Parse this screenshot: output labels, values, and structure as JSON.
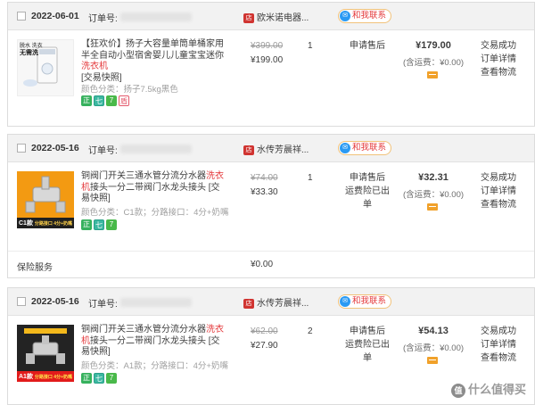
{
  "orders": [
    {
      "date": "2022-06-01",
      "order_label": "订单号:",
      "shop_name": "欧米诺电器...",
      "shop_icon": "店",
      "contact": "和我联系",
      "contact_icon": "✉",
      "title_pre": "【狂欢价】扬子大容量单筒单桶家用半全自动小型宿舍婴儿儿童宝宝迷你",
      "title_hl": "洗衣机",
      "title_post": "[交易快照]",
      "spec": "颜色分类：扬子7.5kg黑色",
      "thumb_text_1": "脱水 洗衣",
      "thumb_text_2": "无需洗",
      "orig_price": "¥399.00",
      "price": "¥199.00",
      "qty": "1",
      "after_sale": [
        "申请售后"
      ],
      "total": "¥179.00",
      "shipping": "(含运费：¥0.00)",
      "actions": [
        "交易成功",
        "订单详情",
        "查看物流"
      ],
      "badges": [
        "正",
        "七",
        "7",
        "盾"
      ]
    },
    {
      "date": "2022-05-16",
      "order_label": "订单号:",
      "shop_name": "水传芳晨祥...",
      "shop_icon": "店",
      "contact": "和我联系",
      "contact_icon": "✉",
      "title_pre": "铜阀门开关三通水管分流分水器",
      "title_hl": "洗衣机",
      "title_post": "接头一分二带阀门水龙头接头 [交易快照]",
      "spec": "颜色分类：C1款；分路接口：4分+奶嘴",
      "thumb_text_1": "C1款",
      "thumb_text_2": "分路接口 4分+奶嘴",
      "orig_price": "¥74.00",
      "price": "¥33.30",
      "qty": "1",
      "after_sale": [
        "申请售后",
        "运费险已出单"
      ],
      "total": "¥32.31",
      "shipping": "(含运费：¥0.00)",
      "actions": [
        "交易成功",
        "订单详情",
        "查看物流"
      ],
      "badges": [
        "正",
        "七",
        "7"
      ],
      "service_label": "保险服务",
      "service_price": "¥0.00"
    },
    {
      "date": "2022-05-16",
      "order_label": "订单号:",
      "shop_name": "水传芳晨祥...",
      "shop_icon": "店",
      "contact": "和我联系",
      "contact_icon": "✉",
      "title_pre": "铜阀门开关三通水管分流分水器",
      "title_hl": "洗衣机",
      "title_post": "接头一分二带阀门水龙头接头 [交易快照]",
      "spec": "颜色分类：A1款；分路接口：4分+奶嘴",
      "thumb_text_1": "A1款",
      "thumb_text_2": "分路接口 4分+奶嘴",
      "orig_price": "¥62.00",
      "price": "¥27.90",
      "qty": "2",
      "after_sale": [
        "申请售后",
        "运费险已出单"
      ],
      "total": "¥54.13",
      "shipping": "(含运费：¥0.00)",
      "actions": [
        "交易成功",
        "订单详情",
        "查看物流"
      ],
      "badges": [
        "正",
        "七",
        "7"
      ]
    }
  ],
  "watermark": {
    "icon": "值",
    "text": "什么值得买"
  },
  "colors": {
    "accent_red": "#e4393c",
    "badge_green": "#36b15d",
    "header_bg": "#f2f2f2"
  }
}
